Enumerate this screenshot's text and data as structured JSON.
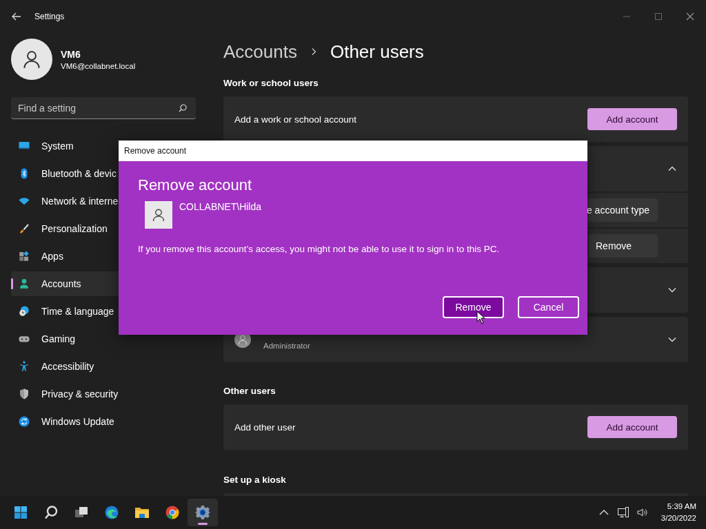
{
  "window": {
    "title": "Settings"
  },
  "profile": {
    "name": "VM6",
    "email": "VM6@collabnet.local"
  },
  "search": {
    "placeholder": "Find a setting"
  },
  "nav": [
    {
      "label": "System",
      "selected": false
    },
    {
      "label": "Bluetooth & devic",
      "selected": false
    },
    {
      "label": "Network & interne",
      "selected": false
    },
    {
      "label": "Personalization",
      "selected": false
    },
    {
      "label": "Apps",
      "selected": false
    },
    {
      "label": "Accounts",
      "selected": true
    },
    {
      "label": "Time & language",
      "selected": false
    },
    {
      "label": "Gaming",
      "selected": false
    },
    {
      "label": "Accessibility",
      "selected": false
    },
    {
      "label": "Privacy & security",
      "selected": false
    },
    {
      "label": "Windows Update",
      "selected": false
    }
  ],
  "breadcrumb": {
    "parent": "Accounts",
    "current": "Other users"
  },
  "sections": [
    {
      "heading": "Work or school users",
      "cards": [
        {
          "kind": "action",
          "label": "Add a work or school account",
          "button": "Add account"
        },
        {
          "kind": "account",
          "expanded": true,
          "rows": [
            {
              "button": "e account type"
            },
            {
              "button": "Remove"
            }
          ]
        },
        {
          "kind": "account",
          "expanded": false
        },
        {
          "kind": "account",
          "expanded": false,
          "subtitle": "Administrator"
        }
      ]
    },
    {
      "heading": "Other users",
      "cards": [
        {
          "kind": "action",
          "label": "Add other user",
          "button": "Add account"
        }
      ]
    },
    {
      "heading": "Set up a kiosk",
      "cards": [
        {
          "kind": "blank"
        }
      ]
    }
  ],
  "dialog": {
    "title": "Remove account",
    "heading": "Remove account",
    "user": "COLLABNET\\Hilda",
    "message": "If you remove this account’s access, you might not be able to use it to sign in to this PC.",
    "buttons": [
      {
        "label": "Remove",
        "default": true
      },
      {
        "label": "Cancel",
        "default": false
      }
    ]
  },
  "taskbar": {
    "apps": [
      {
        "active": false
      },
      {
        "active": false
      },
      {
        "active": false
      },
      {
        "active": false
      },
      {
        "active": false
      },
      {
        "active": false
      },
      {
        "active": true
      }
    ],
    "time": "5:39 AM",
    "date": "3/20/2022"
  }
}
